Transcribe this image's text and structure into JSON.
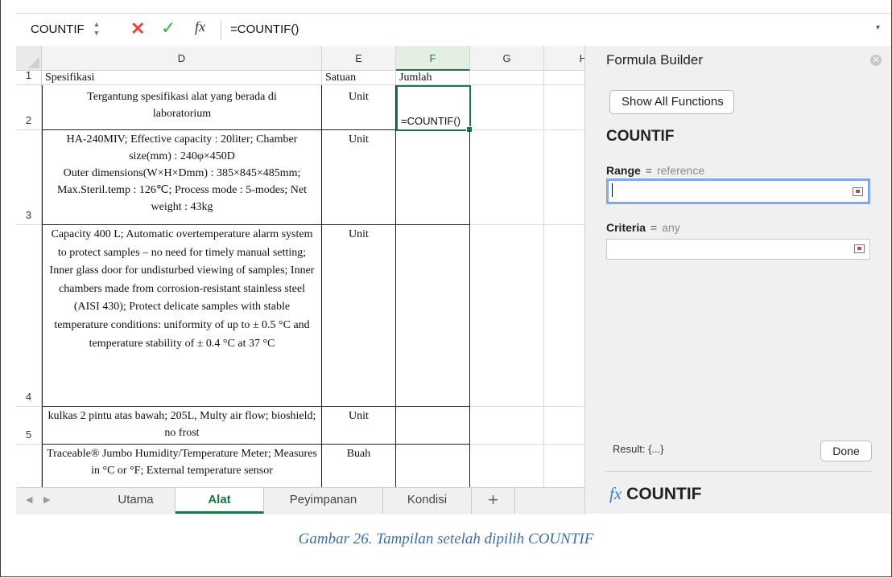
{
  "formula_bar": {
    "name_box": "COUNTIF",
    "spinner_up": "▲",
    "spinner_down": "▼",
    "cancel_icon": "✕",
    "confirm_icon": "✓",
    "fx_label": "fx",
    "content": "=COUNTIF()",
    "dropdown_icon": "▾"
  },
  "grid": {
    "columns": [
      "D",
      "E",
      "F",
      "G",
      "H"
    ],
    "selected_column": "F",
    "rows": [
      {
        "num": "1",
        "d": "Spesifikasi",
        "e": "Satuan",
        "f": "Jumlah"
      },
      {
        "num": "2",
        "d": "Tergantung spesifikasi alat yang berada di laboratorium",
        "e": "Unit",
        "f": "=COUNTIF()"
      },
      {
        "num": "3",
        "d": "HA-240MIV; Effective capacity : 20liter; Chamber size(mm) : 240φ×450D\nOuter dimensions(W×H×Dmm) : 385×845×485mm; Max.Steril.temp : 126℃; Process mode : 5-modes; Net weight : 43kg",
        "e": "Unit",
        "f": ""
      },
      {
        "num": "4",
        "d": "Capacity 400 L; Automatic overtemperature alarm system to protect samples – no need for timely manual setting; Inner glass door for undisturbed viewing of samples;  Inner chambers made from corrosion-resistant stainless steel (AISI 430); Protect delicate samples with stable temperature conditions: uniformity of up to ± 0.5 °C and temperature stability of ± 0.4 °C at 37 °C",
        "e": "Unit",
        "f": ""
      },
      {
        "num": "5",
        "d": "kulkas 2 pintu atas bawah; 205L, Multy air flow; bioshield; no frost",
        "e": "Unit",
        "f": ""
      },
      {
        "num": "",
        "d": "Traceable® Jumbo Humidity/Temperature Meter; Measures in °C or °F; External temperature sensor",
        "e": "Buah",
        "f": ""
      }
    ]
  },
  "sheet_tabs": {
    "nav_prev": "◀",
    "nav_next": "▶",
    "tabs": [
      "Utama",
      "Alat",
      "Peyimpanan",
      "Kondisi"
    ],
    "active": "Alat",
    "add_label": "+"
  },
  "formula_builder": {
    "title": "Formula Builder",
    "close_icon": "✕",
    "show_all": "Show All Functions",
    "function_name": "COUNTIF",
    "args": [
      {
        "name": "Range",
        "eq": "=",
        "hint": "reference",
        "value": ""
      },
      {
        "name": "Criteria",
        "eq": "=",
        "hint": "any",
        "value": ""
      }
    ],
    "result_label": "Result: {...}",
    "done_label": "Done",
    "footer_fx": "fx",
    "footer_name": "COUNTIF"
  },
  "caption": "Gambar 26. Tampilan setelah dipilih COUNTIF"
}
